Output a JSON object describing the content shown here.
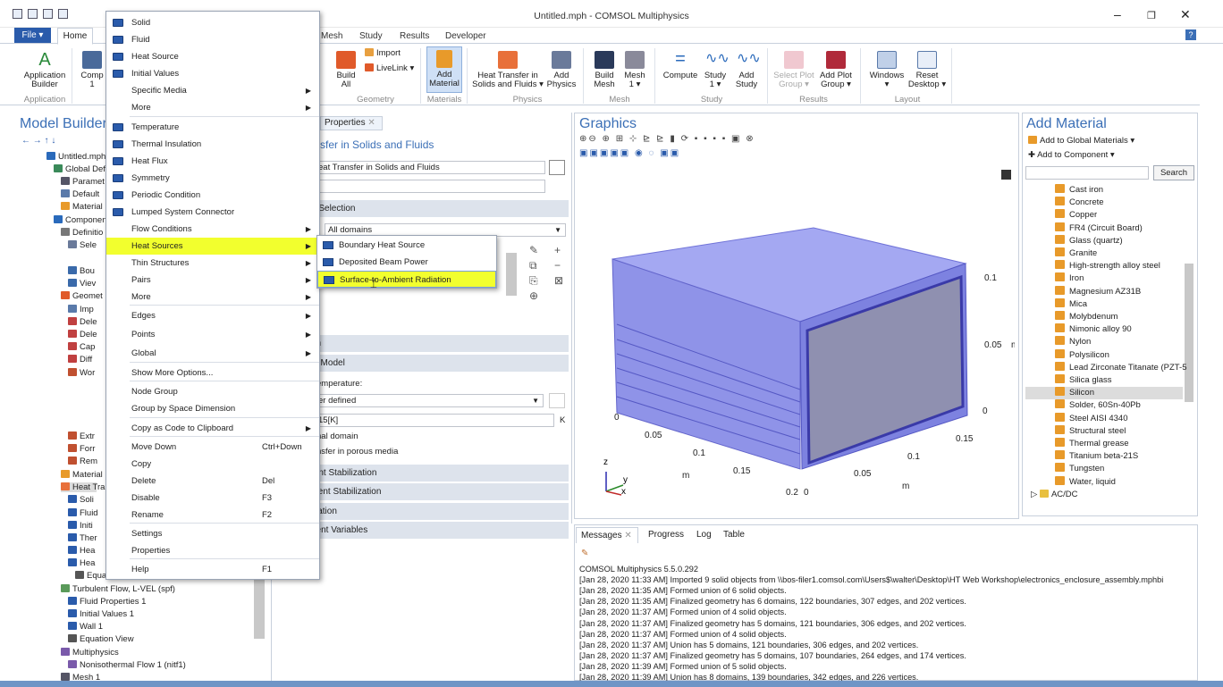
{
  "window": {
    "title": "Untitled.mph - COMSOL Multiphysics"
  },
  "tabs": {
    "file": "File ▾",
    "home": "Home",
    "items": [
      "Mesh",
      "Study",
      "Results",
      "Developer"
    ]
  },
  "ribbon": {
    "application_builder": "Application\nBuilder",
    "component": "Comp\n1",
    "import": "Import",
    "livelink": "LiveLink ▾",
    "build_all": "Build\nAll",
    "add_material": "Add\nMaterial",
    "heat_transfer": "Heat Transfer in\nSolids and Fluids ▾",
    "add_physics": "Add\nPhysics",
    "build_mesh": "Build\nMesh",
    "mesh1": "Mesh\n1 ▾",
    "compute": "Compute",
    "study1": "Study\n1 ▾",
    "add_study": "Add\nStudy",
    "select_plot": "Select Plot\nGroup ▾",
    "add_plot": "Add Plot\nGroup ▾",
    "windows": "Windows\n▾",
    "reset": "Reset\nDesktop ▾",
    "groups": [
      "Application",
      "Geometry",
      "Materials",
      "Physics",
      "Mesh",
      "Study",
      "Results",
      "Layout"
    ]
  },
  "model_builder": {
    "title": "Model Builder",
    "tree": [
      "Untitled.mph (r",
      "Global Defir",
      "Paramet",
      "Default",
      "Material",
      "Componen",
      "Definitio",
      "Sele",
      "Bou",
      "Viev",
      "Geomet",
      "Imp",
      "Dele",
      "Dele",
      "Cap",
      "Diff",
      "Wor",
      "Extr",
      "Forr",
      "Rem",
      "Material",
      "Heat Tra",
      "Soli",
      "Fluid",
      "Initi",
      "Ther",
      "Hea",
      "Hea",
      "Equation View",
      "Turbulent Flow, L-VEL (spf)",
      "Fluid Properties 1",
      "Initial Values 1",
      "Wall 1",
      "Equation View",
      "Multiphysics",
      "Nonisothermal Flow 1 (nitf1)",
      "Mesh 1"
    ]
  },
  "context_menu": {
    "items": [
      {
        "label": "Solid"
      },
      {
        "label": "Fluid"
      },
      {
        "label": "Heat Source"
      },
      {
        "label": "Initial Values"
      },
      {
        "label": "Specific Media",
        "sub": true
      },
      {
        "label": "More",
        "sub": true
      },
      {
        "label": "Temperature"
      },
      {
        "label": "Thermal Insulation"
      },
      {
        "label": "Heat Flux"
      },
      {
        "label": "Symmetry"
      },
      {
        "label": "Periodic Condition"
      },
      {
        "label": "Lumped System Connector"
      },
      {
        "label": "Flow Conditions",
        "sub": true
      },
      {
        "label": "Heat Sources",
        "sub": true
      },
      {
        "label": "Thin Structures",
        "sub": true
      },
      {
        "label": "Pairs",
        "sub": true
      },
      {
        "label": "More",
        "sub": true
      },
      {
        "label": "Edges",
        "sub": true
      },
      {
        "label": "Points",
        "sub": true
      },
      {
        "label": "Global",
        "sub": true
      },
      {
        "label": "Show More Options..."
      },
      {
        "label": "Node Group"
      },
      {
        "label": "Group by Space Dimension"
      },
      {
        "label": "Copy as Code to Clipboard",
        "sub": true
      },
      {
        "label": "Move Down",
        "shortcut": "Ctrl+Down"
      },
      {
        "label": "Copy"
      },
      {
        "label": "Delete",
        "shortcut": "Del"
      },
      {
        "label": "Disable",
        "shortcut": "F3"
      },
      {
        "label": "Rename",
        "shortcut": "F2"
      },
      {
        "label": "Settings"
      },
      {
        "label": "Properties"
      },
      {
        "label": "Help",
        "shortcut": "F1"
      }
    ],
    "submenu": [
      "Boundary Heat Source",
      "Deposited Beam Power",
      "Surface-to-Ambient Radiation"
    ]
  },
  "settings": {
    "tab_properties": "Properties",
    "header": "sfer in Solids and Fluids",
    "label_value": "eat Transfer in Solids and Fluids",
    "sec_selection": "n Selection",
    "all_domains": "All domains",
    "sec_on": "on",
    "sec_model": "al Model",
    "temp_label": "emperature:",
    "user_defined": "er defined",
    "temp_value": "15[K]",
    "unit": "K",
    "opt1": "nal domain",
    "opt2": "nsfer in porous media",
    "sec_stab1": "tent Stabilization",
    "sec_stab2": "stent Stabilization",
    "sec_iz": "ization",
    "sec_dep": "dent Variables"
  },
  "graphics": {
    "title": "Graphics",
    "ticks": [
      "0.1",
      "0.05",
      "m",
      "0",
      "0",
      "0.05",
      "0.1",
      "0.15",
      "m",
      "0.2",
      "0",
      "0.05",
      "0.1",
      "0.15",
      "m"
    ],
    "axes": [
      "z",
      "y",
      "x"
    ]
  },
  "add_material": {
    "title": "Add Material",
    "global": "Add to Global Materials ▾",
    "component": "Add to Component ▾",
    "search": "Search",
    "items": [
      "Cast iron",
      "Concrete",
      "Copper",
      "FR4 (Circuit Board)",
      "Glass (quartz)",
      "Granite",
      "High-strength alloy steel",
      "Iron",
      "Magnesium AZ31B",
      "Mica",
      "Molybdenum",
      "Nimonic alloy 90",
      "Nylon",
      "Polysilicon",
      "Lead Zirconate Titanate (PZT-5",
      "Silica glass",
      "Silicon",
      "Solder, 60Sn-40Pb",
      "Steel AISI 4340",
      "Structural steel",
      "Thermal grease",
      "Titanium beta-21S",
      "Tungsten",
      "Water, liquid"
    ],
    "acdc": "AC/DC"
  },
  "messages": {
    "tabs": [
      "Messages",
      "Progress",
      "Log",
      "Table"
    ],
    "lines": [
      "COMSOL Multiphysics 5.5.0.292",
      "[Jan 28, 2020 11:33 AM] Imported 9 solid objects from \\\\bos-filer1.comsol.com\\Users$\\walter\\Desktop\\HT Web Workshop\\electronics_enclosure_assembly.mphbi",
      "[Jan 28, 2020 11:35 AM] Formed union of 6 solid objects.",
      "[Jan 28, 2020 11:35 AM] Finalized geometry has 6 domains, 122 boundaries, 307 edges, and 202 vertices.",
      "[Jan 28, 2020 11:37 AM] Formed union of 4 solid objects.",
      "[Jan 28, 2020 11:37 AM] Finalized geometry has 5 domains, 121 boundaries, 306 edges, and 202 vertices.",
      "[Jan 28, 2020 11:37 AM] Formed union of 4 solid objects.",
      "[Jan 28, 2020 11:37 AM] Union has 5 domains, 121 boundaries, 306 edges, and 202 vertices.",
      "[Jan 28, 2020 11:37 AM] Finalized geometry has 5 domains, 107 boundaries, 264 edges, and 174 vertices.",
      "[Jan 28, 2020 11:39 AM] Formed union of 5 solid objects.",
      "[Jan 28, 2020 11:39 AM] Union has 8 domains, 139 boundaries, 342 edges, and 226 vertices."
    ]
  },
  "colors": {
    "accent": "#3b6fb6",
    "highlight": "#f2ff2e",
    "geometry": "#9a9ef0"
  }
}
